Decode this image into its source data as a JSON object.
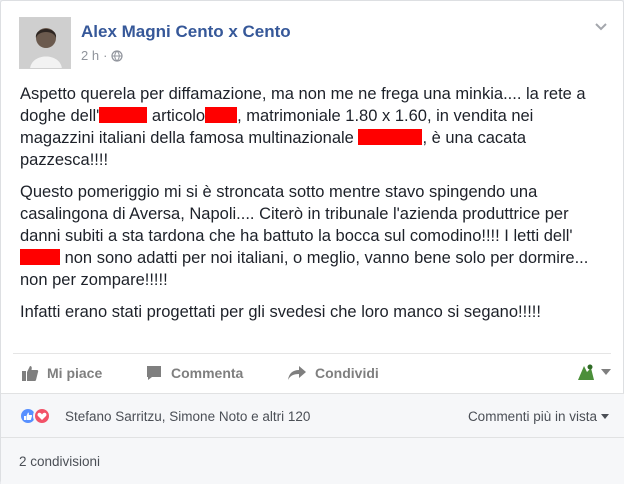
{
  "post": {
    "author": "Alex Magni Cento x Cento",
    "time": "2 h",
    "meta_separator": "·",
    "paragraphs": [
      {
        "segments": [
          {
            "t": "Aspetto querela per diffamazione, ma non me ne frega una minkia.... la rete a doghe dell'"
          },
          {
            "redact": true
          },
          {
            "t": " articolo"
          },
          {
            "redact": true
          },
          {
            "t": ", matrimoniale 1.80 x 1.60, in vendita nei magazzini italiani della famosa multinazionale "
          },
          {
            "redact": true
          },
          {
            "t": ", è una cacata pazzesca!!!!"
          }
        ]
      },
      {
        "segments": [
          {
            "t": "Questo pomeriggio mi si è stroncata sotto mentre stavo spingendo una casalingona di Aversa, Napoli.... Citerò in tribunale l'azienda produttrice per danni subiti a sta tardona che ha battuto la bocca sul comodino!!!! I letti dell'"
          },
          {
            "redact": true
          },
          {
            "t": " non sono adatti per noi italiani, o meglio, vanno bene solo per dormire... non per zompare!!!!!"
          }
        ]
      },
      {
        "segments": [
          {
            "t": "Infatti erano stati progettati per gli svedesi che loro manco si segano!!!!!"
          }
        ]
      }
    ]
  },
  "actions": {
    "like": "Mi piace",
    "comment": "Commenta",
    "share": "Condividi"
  },
  "reactions": {
    "summary": "Stefano Sarritzu, Simone Noto e altri 120",
    "sort_label": "Commenti più in vista"
  },
  "shares": {
    "label": "2 condivisioni"
  },
  "colors": {
    "author_link": "#365899",
    "redaction": "#ff0000",
    "like_reaction": "#5890ff",
    "love_reaction": "#f25268"
  },
  "icons": [
    "globe-icon",
    "chevron-down-icon",
    "thumbs-up-icon",
    "comment-icon",
    "share-arrow-icon",
    "reaction-selector-icon"
  ]
}
